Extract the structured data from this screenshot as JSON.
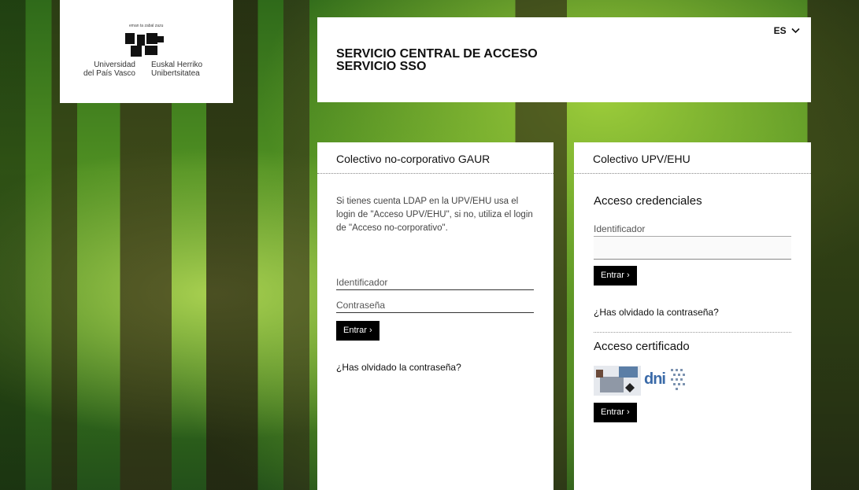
{
  "logo": {
    "tagline": "eman ta zabal zazu",
    "left_text": [
      "Universidad",
      "del País Vasco"
    ],
    "right_text": [
      "Euskal Herriko",
      "Unibertsitatea"
    ]
  },
  "header": {
    "title_line1": "SERVICIO CENTRAL DE ACCESO",
    "title_line2": "SERVICIO SSO",
    "language": "ES",
    "language_icon": "chevron-down-icon"
  },
  "left_panel": {
    "title": "Colectivo no-corporativo GAUR",
    "note": "Si tienes cuenta LDAP en la UPV/EHU usa el login de \"Acceso UPV/EHU\", si no, utiliza el login de \"Acceso no-corporativo\".",
    "id_placeholder": "Identificador",
    "password_placeholder": "Contraseña",
    "submit_label": "Entrar",
    "forgot_link": "¿Has olvidado la contraseña?"
  },
  "right_panel": {
    "title": "Colectivo UPV/EHU",
    "credentials_heading": "Acceso credenciales",
    "id_label": "Identificador",
    "id_value": "",
    "submit_label": "Entrar",
    "forgot_link": "¿Has olvidado la contraseña?",
    "certificate_heading": "Acceso certificado",
    "dni_text": "dni",
    "certificate_submit_label": "Entrar"
  }
}
